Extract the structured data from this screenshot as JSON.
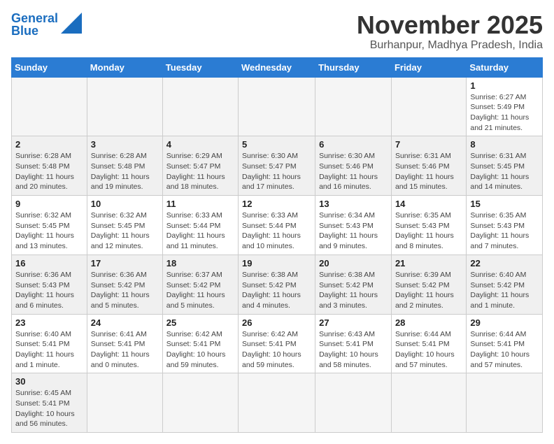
{
  "logo": {
    "text1": "General",
    "text2": "Blue"
  },
  "title": "November 2025",
  "subtitle": "Burhanpur, Madhya Pradesh, India",
  "days_of_week": [
    "Sunday",
    "Monday",
    "Tuesday",
    "Wednesday",
    "Thursday",
    "Friday",
    "Saturday"
  ],
  "weeks": [
    [
      {
        "day": "",
        "info": ""
      },
      {
        "day": "",
        "info": ""
      },
      {
        "day": "",
        "info": ""
      },
      {
        "day": "",
        "info": ""
      },
      {
        "day": "",
        "info": ""
      },
      {
        "day": "",
        "info": ""
      },
      {
        "day": "1",
        "info": "Sunrise: 6:27 AM\nSunset: 5:49 PM\nDaylight: 11 hours and 21 minutes."
      }
    ],
    [
      {
        "day": "2",
        "info": "Sunrise: 6:28 AM\nSunset: 5:48 PM\nDaylight: 11 hours and 20 minutes."
      },
      {
        "day": "3",
        "info": "Sunrise: 6:28 AM\nSunset: 5:48 PM\nDaylight: 11 hours and 19 minutes."
      },
      {
        "day": "4",
        "info": "Sunrise: 6:29 AM\nSunset: 5:47 PM\nDaylight: 11 hours and 18 minutes."
      },
      {
        "day": "5",
        "info": "Sunrise: 6:30 AM\nSunset: 5:47 PM\nDaylight: 11 hours and 17 minutes."
      },
      {
        "day": "6",
        "info": "Sunrise: 6:30 AM\nSunset: 5:46 PM\nDaylight: 11 hours and 16 minutes."
      },
      {
        "day": "7",
        "info": "Sunrise: 6:31 AM\nSunset: 5:46 PM\nDaylight: 11 hours and 15 minutes."
      },
      {
        "day": "8",
        "info": "Sunrise: 6:31 AM\nSunset: 5:45 PM\nDaylight: 11 hours and 14 minutes."
      }
    ],
    [
      {
        "day": "9",
        "info": "Sunrise: 6:32 AM\nSunset: 5:45 PM\nDaylight: 11 hours and 13 minutes."
      },
      {
        "day": "10",
        "info": "Sunrise: 6:32 AM\nSunset: 5:45 PM\nDaylight: 11 hours and 12 minutes."
      },
      {
        "day": "11",
        "info": "Sunrise: 6:33 AM\nSunset: 5:44 PM\nDaylight: 11 hours and 11 minutes."
      },
      {
        "day": "12",
        "info": "Sunrise: 6:33 AM\nSunset: 5:44 PM\nDaylight: 11 hours and 10 minutes."
      },
      {
        "day": "13",
        "info": "Sunrise: 6:34 AM\nSunset: 5:43 PM\nDaylight: 11 hours and 9 minutes."
      },
      {
        "day": "14",
        "info": "Sunrise: 6:35 AM\nSunset: 5:43 PM\nDaylight: 11 hours and 8 minutes."
      },
      {
        "day": "15",
        "info": "Sunrise: 6:35 AM\nSunset: 5:43 PM\nDaylight: 11 hours and 7 minutes."
      }
    ],
    [
      {
        "day": "16",
        "info": "Sunrise: 6:36 AM\nSunset: 5:43 PM\nDaylight: 11 hours and 6 minutes."
      },
      {
        "day": "17",
        "info": "Sunrise: 6:36 AM\nSunset: 5:42 PM\nDaylight: 11 hours and 5 minutes."
      },
      {
        "day": "18",
        "info": "Sunrise: 6:37 AM\nSunset: 5:42 PM\nDaylight: 11 hours and 5 minutes."
      },
      {
        "day": "19",
        "info": "Sunrise: 6:38 AM\nSunset: 5:42 PM\nDaylight: 11 hours and 4 minutes."
      },
      {
        "day": "20",
        "info": "Sunrise: 6:38 AM\nSunset: 5:42 PM\nDaylight: 11 hours and 3 minutes."
      },
      {
        "day": "21",
        "info": "Sunrise: 6:39 AM\nSunset: 5:42 PM\nDaylight: 11 hours and 2 minutes."
      },
      {
        "day": "22",
        "info": "Sunrise: 6:40 AM\nSunset: 5:42 PM\nDaylight: 11 hours and 1 minute."
      }
    ],
    [
      {
        "day": "23",
        "info": "Sunrise: 6:40 AM\nSunset: 5:41 PM\nDaylight: 11 hours and 1 minute."
      },
      {
        "day": "24",
        "info": "Sunrise: 6:41 AM\nSunset: 5:41 PM\nDaylight: 11 hours and 0 minutes."
      },
      {
        "day": "25",
        "info": "Sunrise: 6:42 AM\nSunset: 5:41 PM\nDaylight: 10 hours and 59 minutes."
      },
      {
        "day": "26",
        "info": "Sunrise: 6:42 AM\nSunset: 5:41 PM\nDaylight: 10 hours and 59 minutes."
      },
      {
        "day": "27",
        "info": "Sunrise: 6:43 AM\nSunset: 5:41 PM\nDaylight: 10 hours and 58 minutes."
      },
      {
        "day": "28",
        "info": "Sunrise: 6:44 AM\nSunset: 5:41 PM\nDaylight: 10 hours and 57 minutes."
      },
      {
        "day": "29",
        "info": "Sunrise: 6:44 AM\nSunset: 5:41 PM\nDaylight: 10 hours and 57 minutes."
      }
    ],
    [
      {
        "day": "30",
        "info": "Sunrise: 6:45 AM\nSunset: 5:41 PM\nDaylight: 10 hours and 56 minutes."
      },
      {
        "day": "",
        "info": ""
      },
      {
        "day": "",
        "info": ""
      },
      {
        "day": "",
        "info": ""
      },
      {
        "day": "",
        "info": ""
      },
      {
        "day": "",
        "info": ""
      },
      {
        "day": "",
        "info": ""
      }
    ]
  ]
}
